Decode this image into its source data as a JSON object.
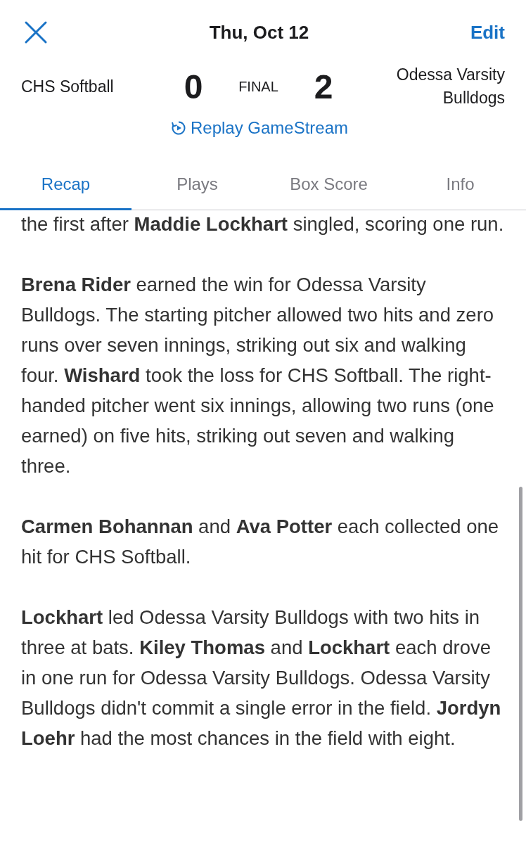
{
  "header": {
    "date": "Thu, Oct 12",
    "edit": "Edit"
  },
  "score": {
    "home_team": "CHS Softball",
    "home_score": "0",
    "status": "FINAL",
    "away_score": "2",
    "away_team": "Odessa Varsity Bulldogs"
  },
  "replay": "Replay GameStream",
  "tabs": [
    {
      "label": "Recap",
      "selected": true
    },
    {
      "label": "Plays",
      "selected": false
    },
    {
      "label": "Box Score",
      "selected": false
    },
    {
      "label": "Info",
      "selected": false
    }
  ],
  "paragraphs": [
    "the first after **Maddie Lockhart** singled, scoring one run.",
    "**Brena Rider** earned the win for Odessa Varsity Bulldogs. The starting pitcher allowed two hits and zero runs over seven innings, striking out six and walking four. **Wishard** took the loss for CHS Softball. The right-handed pitcher went six innings, allowing two runs (one earned) on five hits, striking out seven and walking three.",
    "**Carmen Bohannan** and **Ava Potter** each collected one hit for CHS Softball.",
    "**Lockhart** led Odessa Varsity Bulldogs with two hits in three at bats. **Kiley Thomas** and **Lockhart** each drove in one run for Odessa Varsity Bulldogs. Odessa Varsity Bulldogs didn't commit a single error in the field. **Jordyn Loehr** had the most chances in the field with eight."
  ]
}
